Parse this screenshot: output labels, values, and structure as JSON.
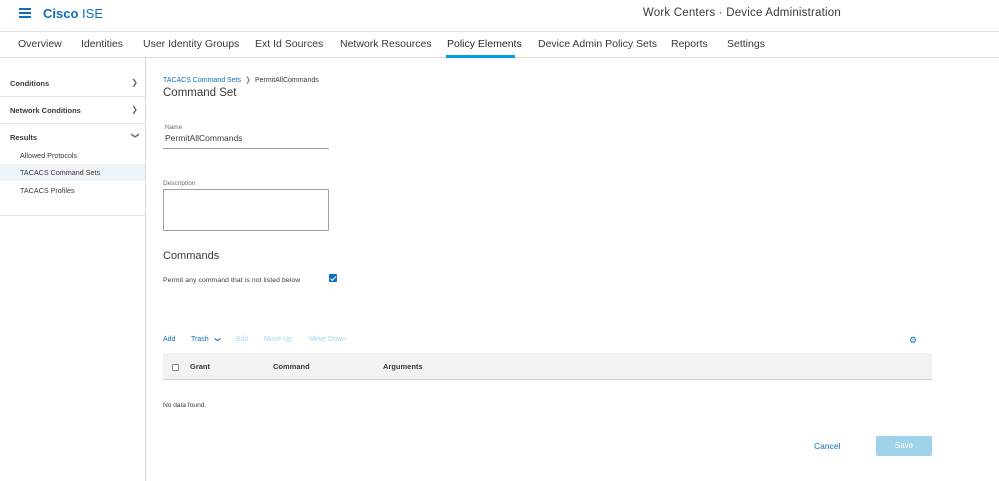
{
  "header": {
    "brand_bold": "Cisco",
    "brand_light": "ISE",
    "context": "Work Centers · Device Administration"
  },
  "nav": {
    "tabs": [
      {
        "label": "Overview"
      },
      {
        "label": "Identities"
      },
      {
        "label": "User Identity Groups"
      },
      {
        "label": "Ext Id Sources"
      },
      {
        "label": "Network Resources"
      },
      {
        "label": "Policy Elements"
      },
      {
        "label": "Device Admin Policy Sets"
      },
      {
        "label": "Reports"
      },
      {
        "label": "Settings"
      }
    ],
    "active": "Policy Elements"
  },
  "sidebar": {
    "sections": [
      {
        "label": "Conditions",
        "expanded": false
      },
      {
        "label": "Network Conditions",
        "expanded": false
      },
      {
        "label": "Results",
        "expanded": true
      }
    ],
    "items": [
      {
        "label": "Allowed Protocols"
      },
      {
        "label": "TACACS Command Sets"
      },
      {
        "label": "TACACS Profiles"
      }
    ],
    "selected": "TACACS Command Sets"
  },
  "breadcrumb": {
    "parent": "TACACS Command Sets",
    "current": "PermitAllCommands"
  },
  "page": {
    "title": "Command Set"
  },
  "form": {
    "name_label": "Name",
    "name_value": "PermitAllCommands",
    "description_label": "Description",
    "description_value": ""
  },
  "commands": {
    "title": "Commands",
    "permit_label": "Permit any command that is not listed below",
    "permit_checked": true,
    "toolbar": {
      "add": "Add",
      "trash": "Trash",
      "edit": "Edit",
      "move_up": "Move Up",
      "move_down": "Move Down"
    },
    "columns": {
      "grant": "Grant",
      "command": "Command",
      "arguments": "Arguments"
    },
    "empty_text": "No data found."
  },
  "actions": {
    "cancel": "Cancel",
    "save": "Save"
  },
  "icons": {
    "menu": "hamburger-icon",
    "chevron_right": "chevron-right-icon",
    "chevron_down": "chevron-down-icon",
    "settings": "gear-icon"
  },
  "colors": {
    "accent": "#0d6ebc",
    "active_tab_underline": "#049fd9",
    "disabled_link": "#9fd3ec",
    "save_disabled_bg": "#9fd3ec"
  }
}
